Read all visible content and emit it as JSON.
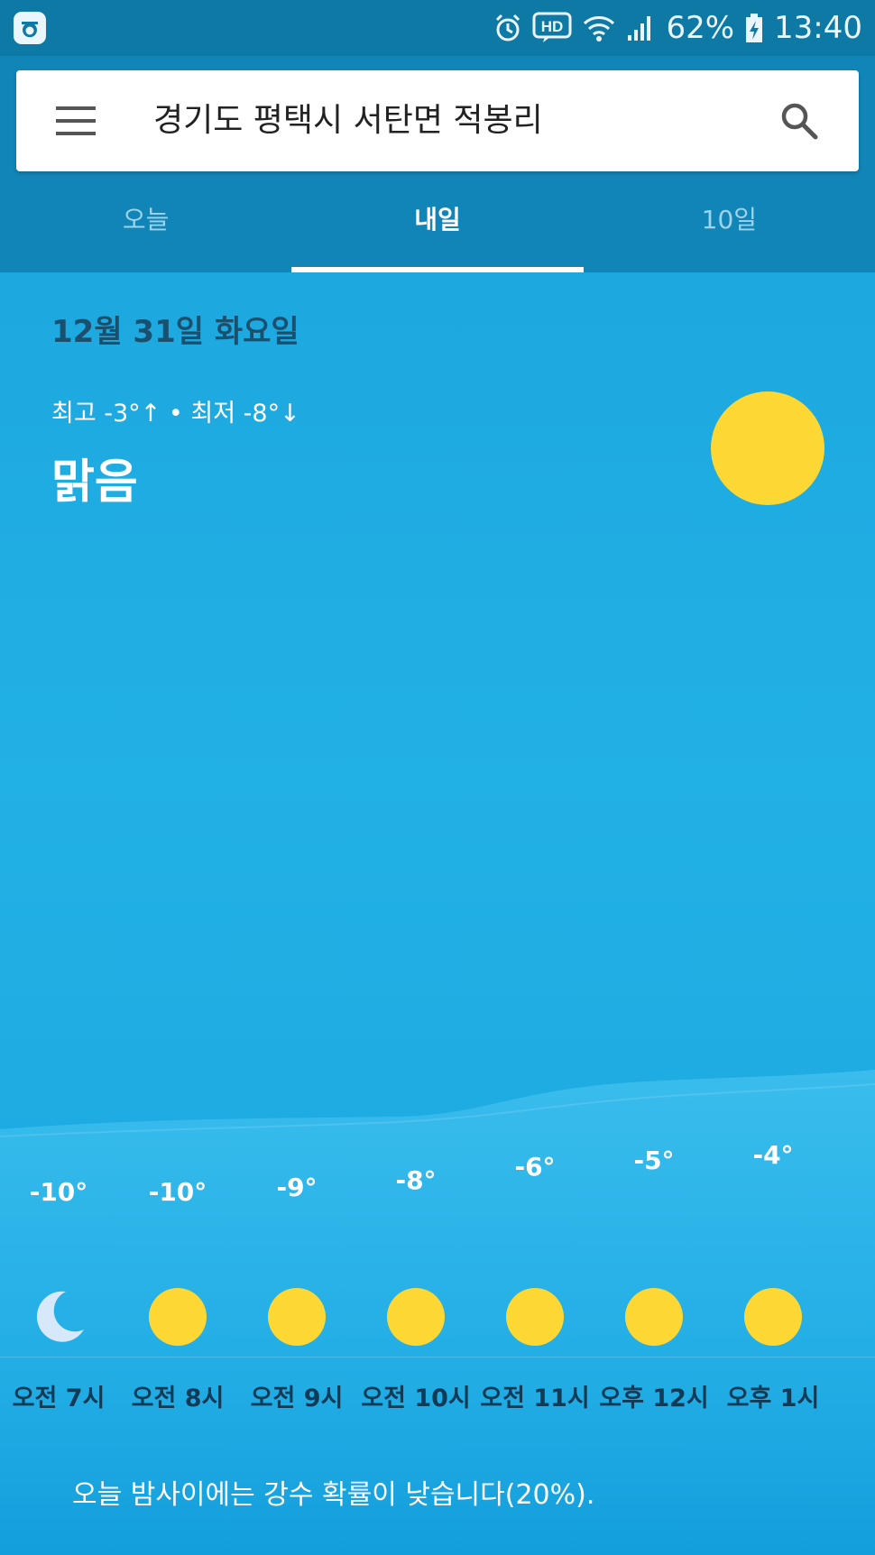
{
  "status_bar": {
    "battery": "62%",
    "time": "13:40",
    "hd_label": "HD",
    "icons": [
      "app-notification-icon",
      "alarm-icon",
      "hd-voice-icon",
      "wifi-icon",
      "signal-icon",
      "battery-charging-icon"
    ]
  },
  "header": {
    "location": "경기도 평택시 서탄면 적봉리",
    "menu_icon": "menu-icon",
    "search_icon": "search-icon"
  },
  "tabs": [
    {
      "label": "오늘",
      "active": false
    },
    {
      "label": "내일",
      "active": true
    },
    {
      "label": "10일",
      "active": false
    }
  ],
  "summary": {
    "date": "12월 31일 화요일",
    "high_low": "최고 -3°↑ • 최저 -8°↓",
    "condition": "맑음",
    "icon": "sun-icon"
  },
  "hourly": [
    {
      "temp": "-10°",
      "icon": "moon-icon",
      "time": "오전 7시"
    },
    {
      "temp": "-10°",
      "icon": "sun-icon",
      "time": "오전 8시"
    },
    {
      "temp": "-9°",
      "icon": "sun-icon",
      "time": "오전 9시"
    },
    {
      "temp": "-8°",
      "icon": "sun-icon",
      "time": "오전 10시"
    },
    {
      "temp": "-6°",
      "icon": "sun-icon",
      "time": "오전 11시"
    },
    {
      "temp": "-5°",
      "icon": "sun-icon",
      "time": "오후 12시"
    },
    {
      "temp": "-4°",
      "icon": "sun-icon",
      "time": "오후 1시"
    }
  ],
  "forecast_note": "오늘 밤사이에는 강수 확률이 낮습니다(20%).",
  "colors": {
    "status_bar": "#0f79a6",
    "app_bar": "#1285b8",
    "sky": "#1aa5e0",
    "sun": "#fdd835",
    "moon": "#d8e8fb"
  }
}
